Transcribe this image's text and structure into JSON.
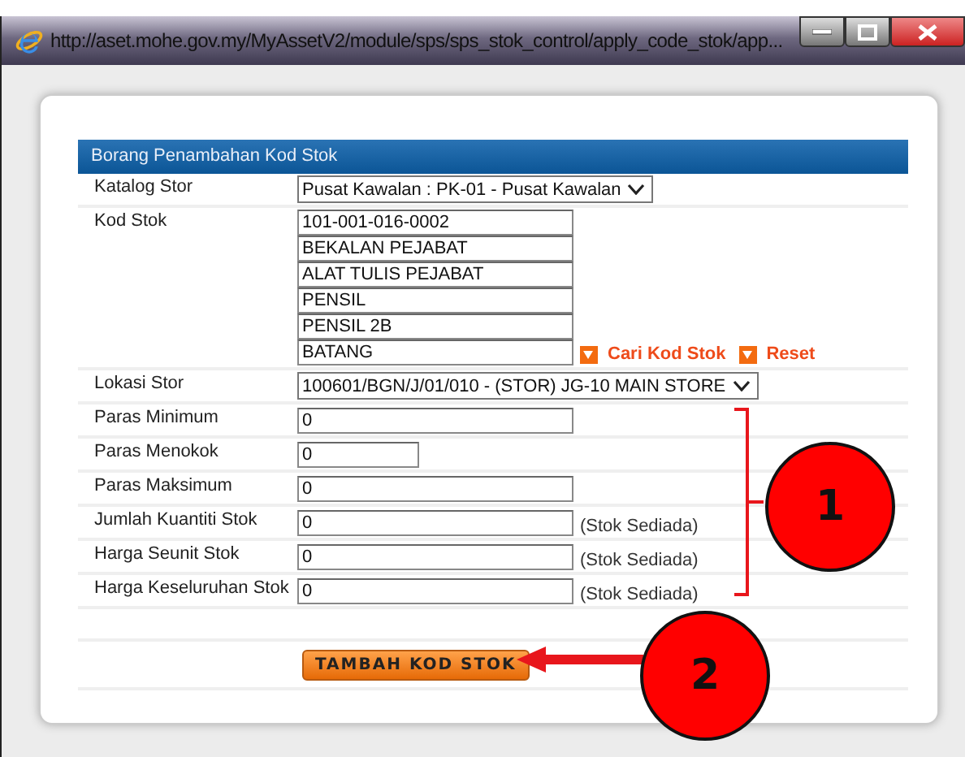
{
  "window": {
    "title": "http://aset.mohe.gov.my/MyAssetV2/module/sps/sps_stok_control/apply_code_stok/app..."
  },
  "form": {
    "title": "Borang Penambahan Kod Stok",
    "rows": [
      {
        "kind": "select",
        "label": "Katalog Stor",
        "value": "Pusat Kawalan : PK-01 - Pusat Kawalan"
      },
      {
        "kind": "stack",
        "label": "Kod Stok",
        "values": [
          "101-001-016-0002",
          "BEKALAN PEJABAT",
          "ALAT TULIS PEJABAT",
          "PENSIL",
          "PENSIL 2B",
          "BATANG"
        ],
        "links": [
          "Cari Kod Stok",
          "Reset"
        ]
      },
      {
        "kind": "select",
        "label": "Lokasi Stor",
        "value": "100601/BGN/J/01/010 - (STOR) JG-10 MAIN STORE"
      },
      {
        "kind": "text",
        "label": "Paras Minimum",
        "value": "0"
      },
      {
        "kind": "short",
        "label": "Paras Menokok",
        "value": "0"
      },
      {
        "kind": "text",
        "label": "Paras Maksimum",
        "value": "0"
      },
      {
        "kind": "text",
        "label": "Jumlah Kuantiti Stok",
        "value": "0",
        "note": "(Stok Sediada)"
      },
      {
        "kind": "text",
        "label": "Harga Seunit Stok",
        "value": "0",
        "note": "(Stok Sediada)"
      },
      {
        "kind": "text",
        "label": "Harga Keseluruhan Stok",
        "value": "0",
        "note": "(Stok Sediada)"
      }
    ],
    "button": "TAMBAH KOD STOK"
  },
  "annotations": [
    {
      "kind": "bracket-circle",
      "text": "1"
    },
    {
      "kind": "arrow-circle",
      "text": "2"
    }
  ]
}
